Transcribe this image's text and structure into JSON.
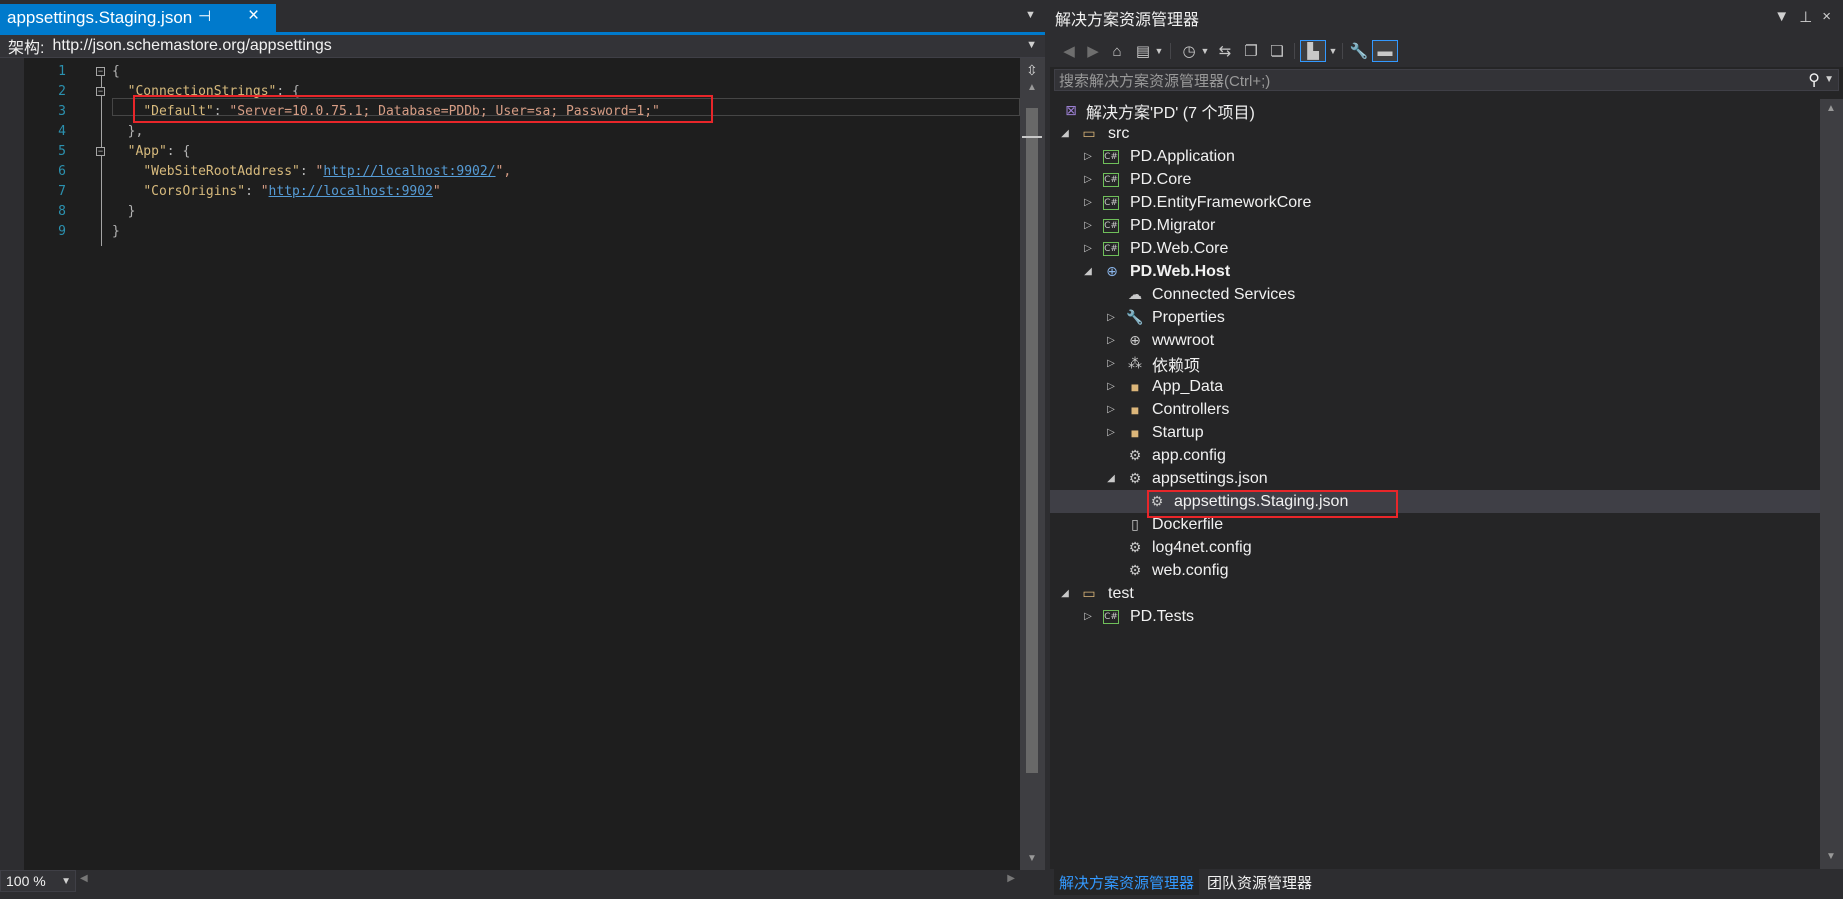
{
  "editor": {
    "tab_title": "appsettings.Staging.json",
    "tab_pin_glyph": "⊣",
    "tab_close_glyph": "×",
    "schema_label": "架构:",
    "schema_value": "http://json.schemastore.org/appsettings",
    "line_numbers": [
      "1",
      "2",
      "3",
      "4",
      "5",
      "6",
      "7",
      "8",
      "9"
    ],
    "zoom": "100 %"
  },
  "code": {
    "l1_open": "{",
    "l2_key": "\"ConnectionStrings\"",
    "l2_rest": ": {",
    "l3_key": "\"Default\"",
    "l3_colon": ": ",
    "l3_value": "\"Server=10.0.75.1; Database=PDDb; User=sa; Password=1;\"",
    "l4": "},",
    "l5_key": "\"App\"",
    "l5_rest": ": {",
    "l6_key": "\"WebSiteRootAddress\"",
    "l6_colon": ": ",
    "l6_q1": "\"",
    "l6_url": "http://localhost:9902/",
    "l6_q2": "\",",
    "l7_key": "\"CorsOrigins\"",
    "l7_colon": ": ",
    "l7_q1": "\"",
    "l7_url": "http://localhost:9902",
    "l7_q2": "\"",
    "l8": "}",
    "l9": "}"
  },
  "solution_explorer": {
    "title": "解决方案资源管理器",
    "search_placeholder": "搜索解决方案资源管理器(Ctrl+;)",
    "tree": {
      "solution": "解决方案'PD' (7 个项目)",
      "src": "src",
      "pd_application": "PD.Application",
      "pd_core": "PD.Core",
      "pd_efcore": "PD.EntityFrameworkCore",
      "pd_migrator": "PD.Migrator",
      "pd_web_core": "PD.Web.Core",
      "pd_web_host": "PD.Web.Host",
      "connected_services": "Connected Services",
      "properties": "Properties",
      "wwwroot": "wwwroot",
      "dependencies": "依赖项",
      "app_data": "App_Data",
      "controllers": "Controllers",
      "startup": "Startup",
      "app_config": "app.config",
      "appsettings_json": "appsettings.json",
      "appsettings_staging": "appsettings.Staging.json",
      "dockerfile": "Dockerfile",
      "log4net_config": "log4net.config",
      "web_config": "web.config",
      "test": "test",
      "pd_tests": "PD.Tests"
    },
    "bottom_tabs": [
      "解决方案资源管理器",
      "团队资源管理器"
    ],
    "cs_badge": "C#"
  },
  "colors": {
    "accent": "#007acc",
    "highlight_red": "#e8262a",
    "editor_bg": "#1e1e1e",
    "json_key": "#d7ba7d",
    "json_string": "#d69d85",
    "link": "#569cd6"
  }
}
